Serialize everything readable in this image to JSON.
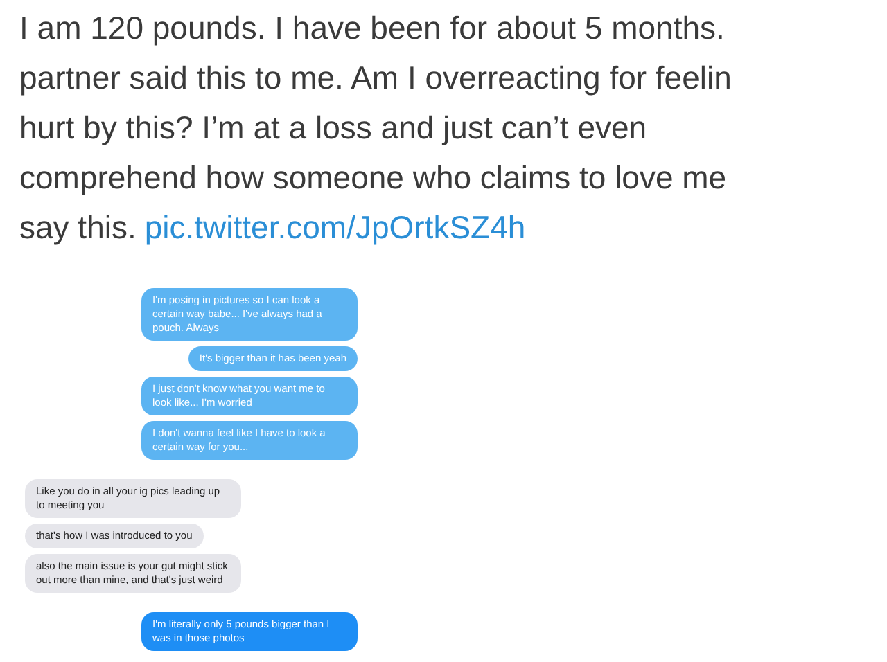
{
  "tweet": {
    "lines": [
      "I am 120 pounds. I have been for about 5 months.",
      "partner said this to me. Am I overreacting for feelin",
      "hurt by this? I’m at a loss and just can’t even",
      "comprehend how someone who claims to love me",
      "say this."
    ],
    "link": "pic.twitter.com/JpOrtkSZ4h"
  },
  "messages": [
    {
      "kind": "sent",
      "color": "#5cb4f2",
      "text": "I'm posing in pictures so I can look a certain way babe... I've always had a pouch. Always"
    },
    {
      "kind": "sent",
      "color": "#5cb4f2",
      "text": "It's bigger than it has been yeah"
    },
    {
      "kind": "sent",
      "color": "#5cb4f2",
      "text": "I just don't know what you want me to look like... I'm worried"
    },
    {
      "kind": "sent",
      "color": "#5cb4f2",
      "text": "I don't wanna feel like I have to look a certain way for you..."
    },
    {
      "kind": "received",
      "text": "Like you do in all your ig pics leading up to meeting you"
    },
    {
      "kind": "received",
      "text": "that's how I was introduced to you"
    },
    {
      "kind": "received",
      "text": "also the main issue is your gut might stick out more than mine, and that's just weird"
    },
    {
      "kind": "sent",
      "color": "#1e8ef5",
      "text": "I'm literally only 5 pounds bigger than I was in those photos"
    }
  ]
}
